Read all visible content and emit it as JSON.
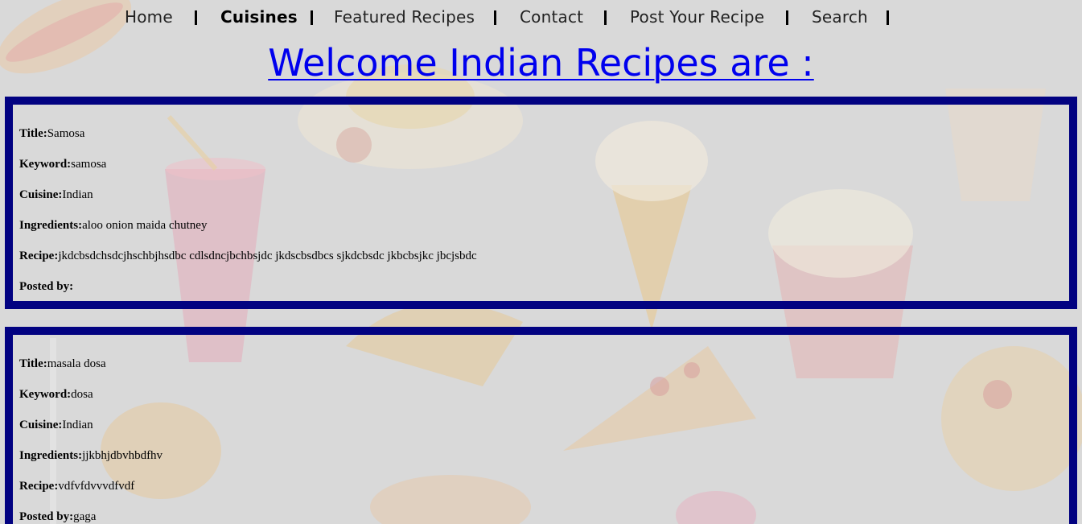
{
  "nav": {
    "items": [
      {
        "label": "Home",
        "active": false
      },
      {
        "label": "Cuisines",
        "active": true
      },
      {
        "label": "Featured Recipes",
        "active": false
      },
      {
        "label": "Contact",
        "active": false
      },
      {
        "label": "Post Your Recipe",
        "active": false
      },
      {
        "label": "Search",
        "active": false
      }
    ]
  },
  "page_title": "Welcome Indian Recipes are :",
  "labels": {
    "title": "Title:",
    "keyword": "Keyword:",
    "cuisine": "Cuisine:",
    "ingredients": "Ingredients:",
    "recipe": "Recipe:",
    "posted_by": "Posted by:"
  },
  "recipes": [
    {
      "title": "Samosa",
      "keyword": "samosa",
      "cuisine": "Indian",
      "ingredients": "aloo onion maida chutney",
      "recipe": "jkdcbsdchsdcjhschbjhsdbc cdlsdncjbchbsjdc jkdscbsdbcs sjkdcbsdc jkbcbsjkc jbcjsbdc",
      "posted_by": ""
    },
    {
      "title": "masala dosa",
      "keyword": "dosa",
      "cuisine": "Indian",
      "ingredients": "jjkbhjdbvhbdfhv",
      "recipe": "vdfvfdvvvdfvdf",
      "posted_by": "gaga"
    }
  ],
  "colors": {
    "card_border": "#020281",
    "title_link": "#0000ee",
    "background": "#d9d9d9"
  }
}
